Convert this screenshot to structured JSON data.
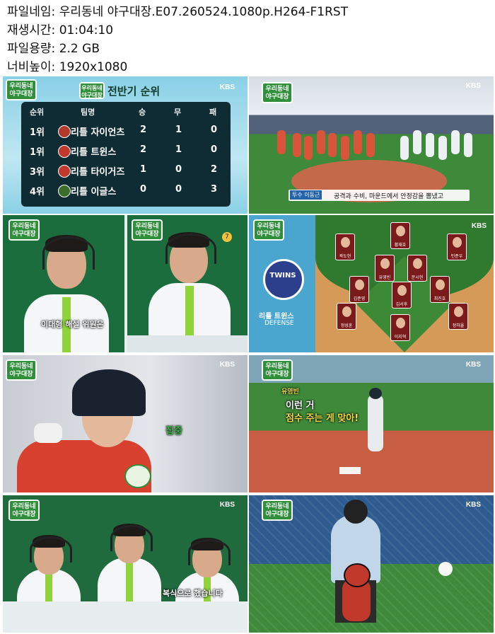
{
  "header": {
    "filename_label": "파일네임:",
    "filename": "우리동네 야구대장.E07.260524.1080p.H264-F1RST",
    "duration_label": "재생시간:",
    "duration": "01:04:10",
    "filesize_label": "파일용량:",
    "filesize": "2.2 GB",
    "resolution_label": "너비높이:",
    "resolution": "1920x1080"
  },
  "show_logo": [
    "우리동네",
    "야구대장"
  ],
  "broadcaster": "KBS",
  "thumb1": {
    "title": "전반기 순위",
    "columns": [
      "순위",
      "팀명",
      "승",
      "무",
      "패"
    ],
    "rows": [
      {
        "rank": "1위",
        "team": "리틀 자이언츠",
        "w": "2",
        "d": "1",
        "l": "0",
        "color": "#b23a2a"
      },
      {
        "rank": "1위",
        "team": "리틀 트윈스",
        "w": "2",
        "d": "1",
        "l": "0",
        "color": "#c0392b"
      },
      {
        "rank": "3위",
        "team": "리틀 타이거즈",
        "w": "1",
        "d": "0",
        "l": "2",
        "color": "#c0392b"
      },
      {
        "rank": "4위",
        "team": "리틀 이글스",
        "w": "0",
        "d": "0",
        "l": "3",
        "color": "#3b6e2a"
      }
    ]
  },
  "thumb2": {
    "caption": "공격과 수비, 마운드에서 안정감을 뽐냈고",
    "name_tag": "투수 이동근"
  },
  "thumb3": {
    "caption": "이대형 해설 위원은",
    "badge": "7"
  },
  "thumb4": {
    "team_label": "리틀 트윈스",
    "defense_label": "DEFENSE",
    "badge": "TWINS",
    "players": [
      "황재호",
      "곽도현",
      "민준우",
      "유영빈",
      "문시현",
      "김준영",
      "김서후",
      "최진호",
      "정성훈",
      "정하율",
      "이지혁"
    ]
  },
  "thumb5": {
    "caption": "집중"
  },
  "thumb6": {
    "caption_line1": "이런 거",
    "caption_line2": "점수 주는 게 맞아!",
    "tag": "유영빈"
  },
  "thumb7": {
    "caption": "복식으로 했습니다"
  },
  "thumb8": {}
}
